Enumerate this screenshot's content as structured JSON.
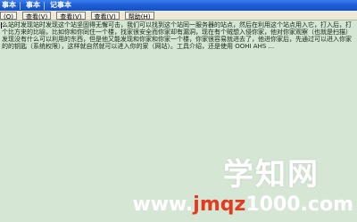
{
  "titlebar": {
    "segments": [
      "事本",
      "事本",
      "记事本"
    ]
  },
  "menubar": {
    "items": [
      "(O)",
      "查看(V)",
      "查看(V)",
      "查看(V)",
      "帮助(H)"
    ]
  },
  "editor": {
    "text": "么站时发现站时发现这个站坚固得无懈可击，我们可以找到这个站同一服务器的站点，然后在利用这个站点用入它，打入后，打个比方来的比喻，比如你和你同住一个楼，找家很安全而你家却有漏洞，现在有个贼想入侵你家，他对你家观察（也就是扫描）发现没有什么可以利用的东西，但是他又能发现和你家和你家一个楼，你家很容易就进去了，他进你家后，先通过可以进入你家的的钥匙（系统权限），这样就自然就可以进入你的家（网站）。工具介绍，还是使用 OOHI AHS ..."
  },
  "watermark": {
    "title": "学知网",
    "url_prefix": "www.",
    "url_highlight": "jmqz",
    "url_suffix": "1000.com"
  }
}
